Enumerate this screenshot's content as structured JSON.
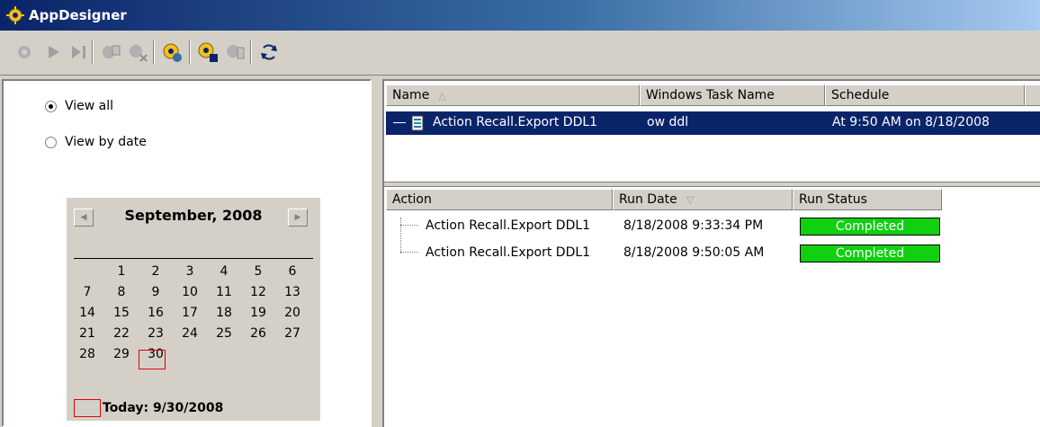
{
  "window": {
    "title": "AppDesigner"
  },
  "view_options": {
    "view_all": "View all",
    "view_by_date": "View by date",
    "selected": "View all"
  },
  "calendar": {
    "month_label": "September, 2008",
    "days": [
      "1",
      "2",
      "3",
      "4",
      "5",
      "6",
      "7",
      "8",
      "9",
      "10",
      "11",
      "12",
      "13",
      "14",
      "15",
      "16",
      "17",
      "18",
      "19",
      "20",
      "21",
      "22",
      "23",
      "24",
      "25",
      "26",
      "27",
      "28",
      "29",
      "30"
    ],
    "first_weekday_index": 1,
    "selected_day": "30",
    "today_label": "Today: 9/30/2008"
  },
  "tasks_table": {
    "columns": [
      "Name",
      "Windows Task Name",
      "Schedule"
    ],
    "rows": [
      {
        "name": "Action Recall.Export DDL1",
        "task_name": "ow ddl",
        "schedule": "At 9:50 AM on 8/18/2008"
      }
    ]
  },
  "runs_table": {
    "columns": [
      "Action",
      "Run Date",
      "Run Status"
    ],
    "rows": [
      {
        "action": "Action Recall.Export DDL1",
        "run_date": "8/18/2008 9:33:34 PM",
        "status": "Completed"
      },
      {
        "action": "Action Recall.Export DDL1",
        "run_date": "8/18/2008 9:50:05 AM",
        "status": "Completed"
      }
    ]
  },
  "colors": {
    "selection": "#0a246a",
    "status_completed": "#10d010",
    "today_marker": "#e00000"
  },
  "toolbar_icons": [
    "run-gear-icon",
    "play-icon",
    "step-icon",
    "copy-gear-icon",
    "delete-gear-icon",
    "schedule-gear-icon",
    "export-gear-icon",
    "properties-gear-icon",
    "refresh-icon"
  ]
}
